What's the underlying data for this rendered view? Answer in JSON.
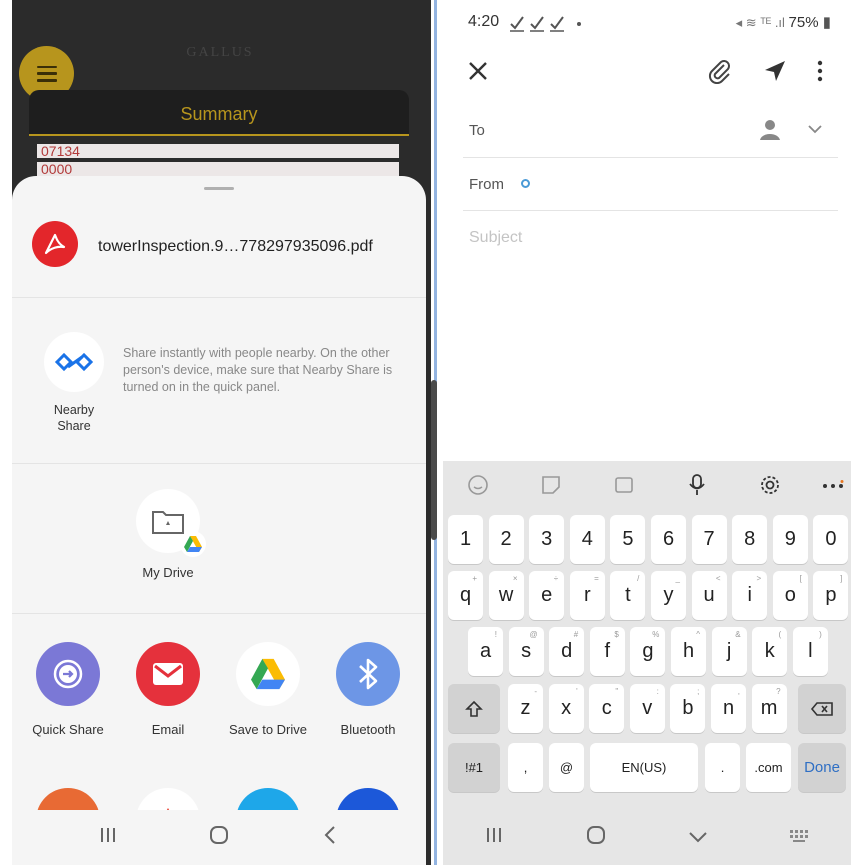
{
  "left": {
    "bg_app_title": "GALLUS",
    "summary_label": "Summary",
    "bg_rows": [
      "07134",
      "0000"
    ],
    "share_sheet": {
      "file_name": "towerInspection.9…778297935096.pdf",
      "nearby": {
        "label": "Nearby Share",
        "description": "Share instantly with people nearby. On the other person's device, make sure that Nearby Share is turned on in the quick panel."
      },
      "drive_target": "My Drive",
      "apps": [
        {
          "label": "Quick Share",
          "icon": "quick-share-icon",
          "color": "#7b78d6"
        },
        {
          "label": "Email",
          "icon": "email-icon",
          "color": "#e5313c"
        },
        {
          "label": "Save to Drive",
          "icon": "google-drive-icon",
          "color": "#ffffff"
        },
        {
          "label": "Bluetooth",
          "icon": "bluetooth-icon",
          "color": "#6d96e6"
        }
      ],
      "peek_colors": [
        "#e86a34",
        "#ffffff",
        "#1ea7e9",
        "#1c58d9"
      ]
    },
    "nav": {
      "recent": "recent-apps-icon",
      "home": "home-icon",
      "back": "back-icon"
    }
  },
  "right": {
    "status_bar": {
      "time": "4:20",
      "battery": "75%"
    },
    "compose": {
      "to_label": "To",
      "from_label": "From",
      "subject_placeholder": "Subject"
    },
    "keyboard": {
      "number_row": [
        "1",
        "2",
        "3",
        "4",
        "5",
        "6",
        "7",
        "8",
        "9",
        "0"
      ],
      "row1": [
        "q",
        "w",
        "e",
        "r",
        "t",
        "y",
        "u",
        "i",
        "o",
        "p"
      ],
      "row1_hints": [
        "+",
        "×",
        "÷",
        "=",
        "/",
        "_",
        "<",
        ">",
        "[",
        "]"
      ],
      "row2": [
        "a",
        "s",
        "d",
        "f",
        "g",
        "h",
        "j",
        "k",
        "l"
      ],
      "row2_hints": [
        "!",
        "@",
        "#",
        "$",
        "%",
        "^",
        "&",
        "(",
        ")"
      ],
      "row3": [
        "z",
        "x",
        "c",
        "v",
        "b",
        "n",
        "m"
      ],
      "row3_hints": [
        "-",
        "'",
        "\"",
        ":",
        ";",
        ",",
        "?"
      ],
      "symbols_key": "!#1",
      "comma_key": ",",
      "at_key": "@",
      "language_key": "EN(US)",
      "period_key": ".",
      "dotcom_key": ".com",
      "done_key": "Done"
    }
  }
}
